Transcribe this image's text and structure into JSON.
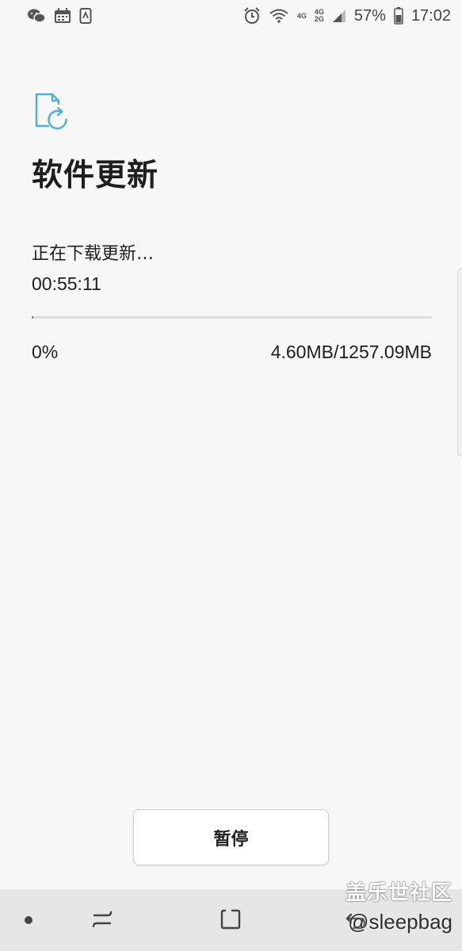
{
  "status_bar": {
    "left_icons": [
      "wechat-icon",
      "calendar-icon",
      "phone-screen-icon"
    ],
    "right_icons": [
      "alarm-icon",
      "wifi-icon",
      "signal-icon",
      "battery-icon"
    ],
    "network_1": "4G",
    "network_2_top": "4G",
    "network_2_bottom": "2G",
    "battery": "57%",
    "time": "17:02"
  },
  "header": {
    "icon": "software-update-icon",
    "title": "软件更新"
  },
  "download": {
    "status": "正在下载更新…",
    "time_remaining": "00:55:11",
    "progress_fraction": 0.004,
    "percent": "0%",
    "size": "4.60MB/1257.09MB"
  },
  "actions": {
    "pause_label": "暂停"
  },
  "nav_bar": {
    "items": [
      "dot-icon",
      "recent-apps-icon",
      "home-icon",
      "back-icon"
    ]
  },
  "watermark": {
    "site": "盖乐世社区",
    "user": "@sleepbag"
  },
  "colors": {
    "accent": "#4db3d6",
    "progress": "#2f7fdc",
    "background": "#f7f7f7",
    "nav_background": "#e6e6e6"
  }
}
